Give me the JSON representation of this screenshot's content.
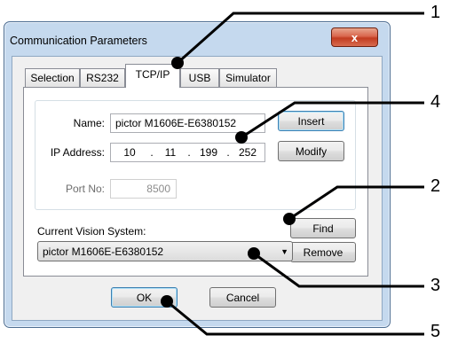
{
  "window": {
    "title": "Communication Parameters",
    "close_glyph": "x"
  },
  "tabs": [
    {
      "label": "Selection",
      "active": false
    },
    {
      "label": "RS232",
      "active": false
    },
    {
      "label": "TCP/IP",
      "active": true
    },
    {
      "label": "USB",
      "active": false
    },
    {
      "label": "Simulator",
      "active": false
    }
  ],
  "form": {
    "name_label": "Name:",
    "name_value": "pictor M1606E-E6380152",
    "ip_label": "IP Address:",
    "ip_octets": [
      "10",
      "11",
      "199",
      "252"
    ],
    "ip_sep": ".",
    "port_label": "Port No:",
    "port_value": "8500"
  },
  "buttons": {
    "insert": "Insert",
    "modify": "Modify",
    "find": "Find",
    "remove": "Remove",
    "ok": "OK",
    "cancel": "Cancel"
  },
  "vision": {
    "label": "Current Vision System:",
    "selected": "pictor M1606E-E6380152"
  },
  "callouts": [
    "1",
    "2",
    "3",
    "4",
    "5"
  ]
}
